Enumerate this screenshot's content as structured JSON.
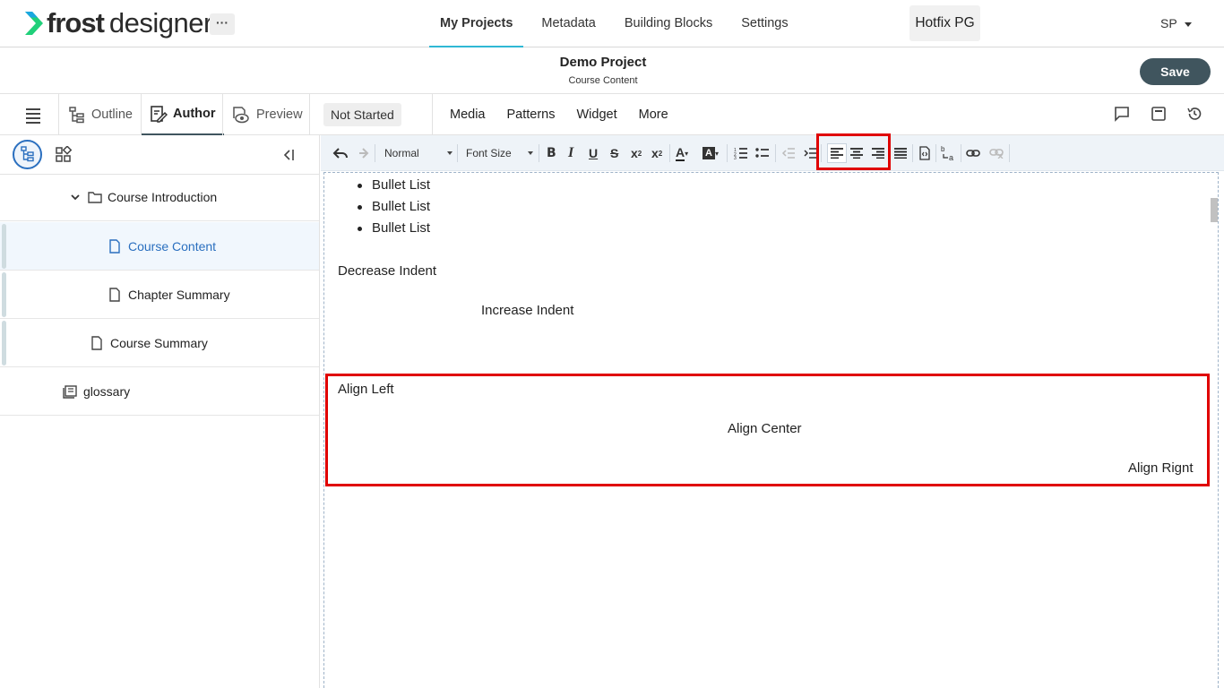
{
  "app": {
    "logo_bold": "frost",
    "logo_light": "designer",
    "more_label": "···"
  },
  "nav": {
    "tabs": [
      "My Projects",
      "Metadata",
      "Building Blocks",
      "Settings"
    ]
  },
  "org_label": "Hotfix PG",
  "user_initials": "SP",
  "project": {
    "title": "Demo Project",
    "subtitle": "Course Content",
    "save_label": "Save"
  },
  "modes": {
    "outline": "Outline",
    "author": "Author",
    "preview": "Preview",
    "status": "Not Started"
  },
  "tools": [
    "Media",
    "Patterns",
    "Widget",
    "More"
  ],
  "tree": {
    "items": [
      {
        "label": "Course Introduction",
        "icon": "folder-icon"
      },
      {
        "label": "Course Content",
        "icon": "page-icon"
      },
      {
        "label": "Chapter Summary",
        "icon": "page-icon"
      },
      {
        "label": "Course Summary",
        "icon": "page-icon"
      },
      {
        "label": "glossary",
        "icon": "glossary-icon"
      }
    ]
  },
  "toolbar": {
    "style": "Normal",
    "font_size": "Font Size"
  },
  "content": {
    "bullets": [
      "Bullet List",
      "Bullet List",
      "Bullet List"
    ],
    "decrease_indent": "Decrease Indent",
    "increase_indent": "Increase Indent",
    "align_left": "Align Left",
    "align_center": "Align Center",
    "align_right": "Align Rignt"
  },
  "colors": {
    "accent": "#2fb8d4",
    "save_bg": "#40555e",
    "highlight": "#e00000",
    "selected_text": "#2a6fbf"
  }
}
